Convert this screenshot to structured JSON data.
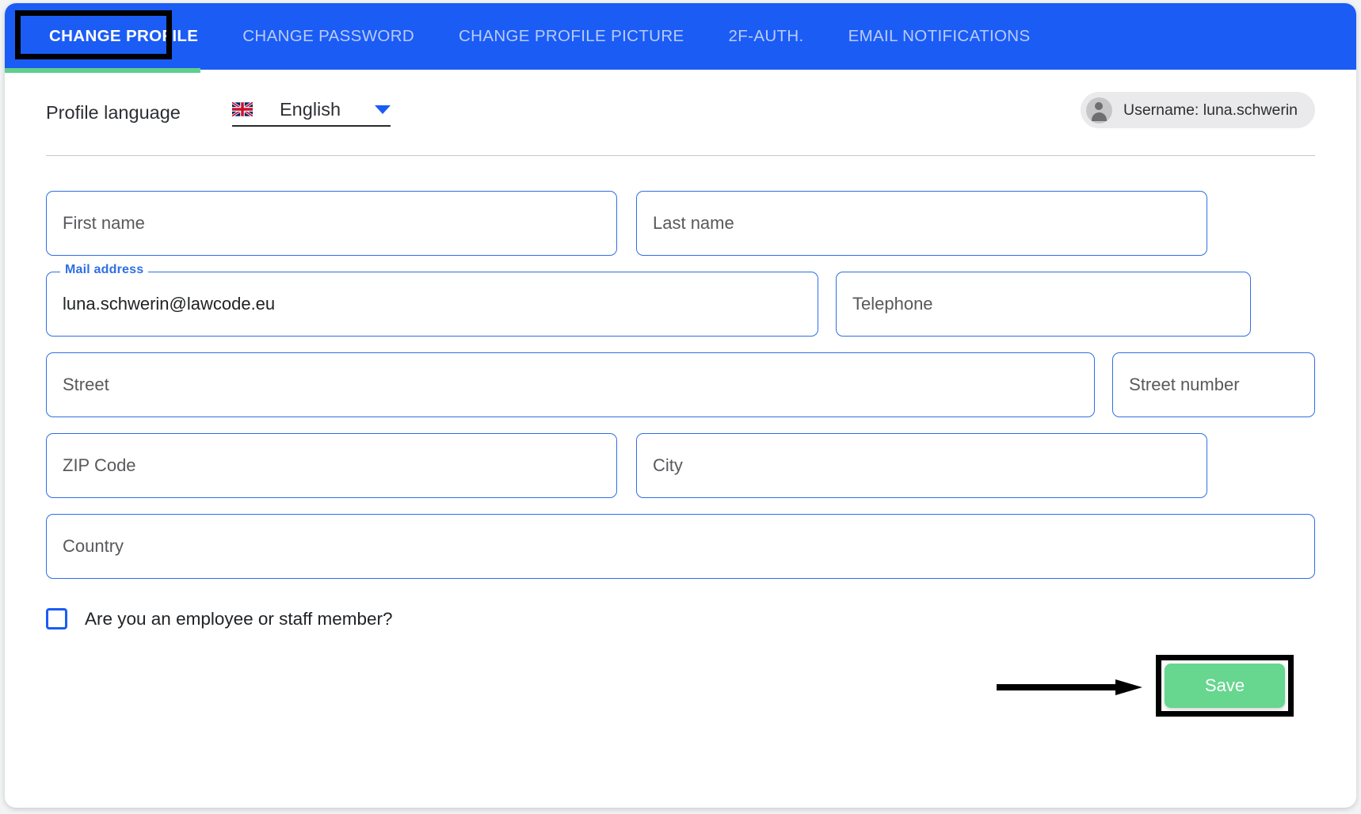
{
  "tabs": [
    {
      "label": "CHANGE PROFILE",
      "active": true
    },
    {
      "label": "CHANGE PASSWORD",
      "active": false
    },
    {
      "label": "CHANGE PROFILE PICTURE",
      "active": false
    },
    {
      "label": "2F-AUTH.",
      "active": false
    },
    {
      "label": "EMAIL NOTIFICATIONS",
      "active": false
    }
  ],
  "language": {
    "label": "Profile language",
    "flag_icon": "uk-flag-icon",
    "value": "English",
    "caret_icon": "chevron-down-icon"
  },
  "user": {
    "avatar_icon": "person-icon",
    "text": "Username: luna.schwerin"
  },
  "form": {
    "first_name": {
      "placeholder": "First name",
      "value": ""
    },
    "last_name": {
      "placeholder": "Last name",
      "value": ""
    },
    "mail_address": {
      "label": "Mail address",
      "value": "luna.schwerin@lawcode.eu"
    },
    "telephone": {
      "placeholder": "Telephone",
      "value": ""
    },
    "street": {
      "placeholder": "Street",
      "value": ""
    },
    "street_number": {
      "placeholder": "Street number",
      "value": ""
    },
    "zip_code": {
      "placeholder": "ZIP Code",
      "value": ""
    },
    "city": {
      "placeholder": "City",
      "value": ""
    },
    "country": {
      "placeholder": "Country",
      "value": ""
    },
    "employee_checkbox": {
      "label": "Are you an employee or staff member?",
      "checked": false
    }
  },
  "save_button": {
    "label": "Save"
  },
  "colors": {
    "tab_bar_blue": "#1b5cf5",
    "tab_active_underline_green": "#5fcf8d",
    "field_border_blue": "#2f6fe4",
    "save_green": "#67d68f",
    "annotation_black": "#000000"
  },
  "annotations": {
    "tab_highlight_box": "CHANGE PROFILE",
    "save_highlight_box": "Save",
    "arrow_icon": "right-arrow-icon"
  }
}
